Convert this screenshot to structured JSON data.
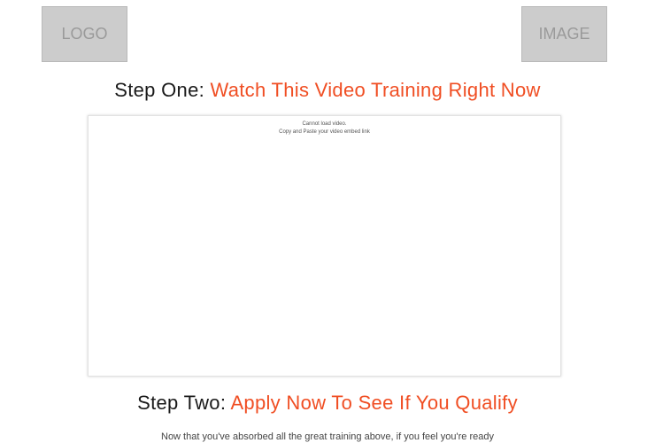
{
  "header": {
    "logo_label": "LOGO",
    "image_label": "IMAGE"
  },
  "step_one": {
    "prefix": "Step One:",
    "accent": "Watch This Video Training Right Now"
  },
  "video": {
    "message_line1": "Cannot load video.",
    "message_line2": "Copy and Paste your video embed link"
  },
  "step_two": {
    "prefix": "Step Two:",
    "accent": "Apply Now To See If You Qualify"
  },
  "body": {
    "text": "Now that you've absorbed all the great training above, if you feel you're ready"
  },
  "colors": {
    "accent": "#f04e23",
    "placeholder": "#cccccc"
  }
}
